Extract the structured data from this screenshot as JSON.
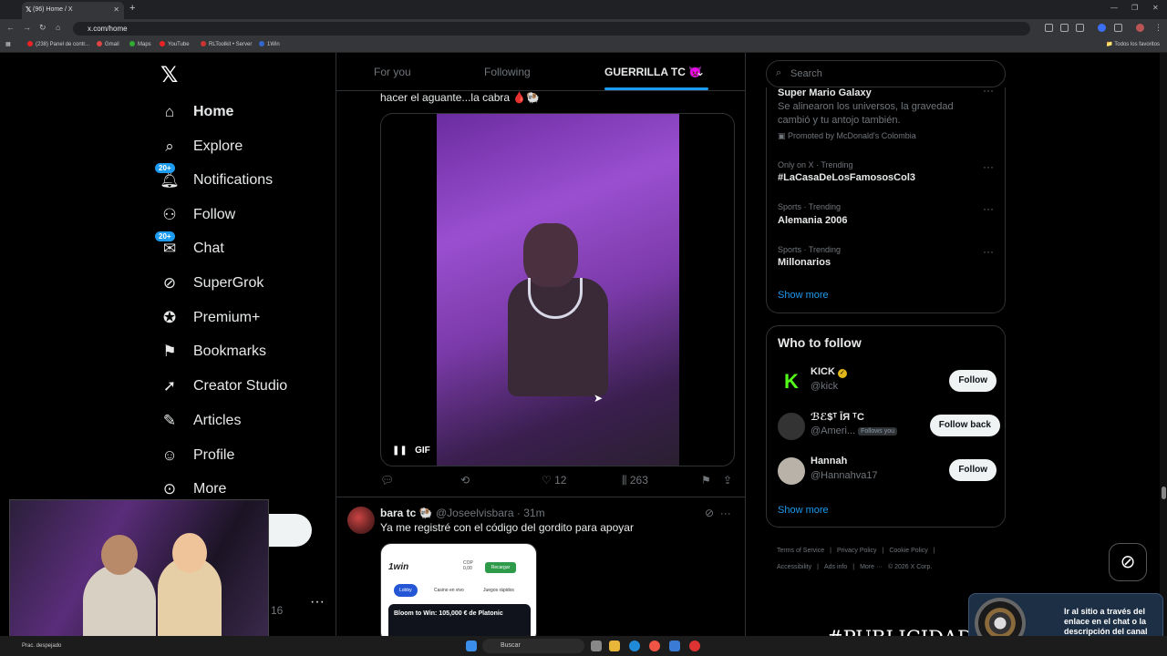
{
  "browser": {
    "tab_title": "(96) Home / X",
    "url": "x.com/home",
    "bookmarks": [
      "(238) Panel de contr...",
      "Gmail",
      "Maps",
      "YouTube",
      "RLToolkit • Server",
      "1Win"
    ],
    "all_bookmarks": "Todos los favoritos"
  },
  "nav": {
    "items": [
      {
        "label": "Home",
        "icon": "home-icon",
        "active": true
      },
      {
        "label": "Explore",
        "icon": "search-icon"
      },
      {
        "label": "Notifications",
        "icon": "bell-icon",
        "badge": "20+"
      },
      {
        "label": "Follow",
        "icon": "person-add-icon"
      },
      {
        "label": "Chat",
        "icon": "chat-icon",
        "badge": "20+"
      },
      {
        "label": "SuperGrok",
        "icon": "grok-icon"
      },
      {
        "label": "Premium+",
        "icon": "verified-icon"
      },
      {
        "label": "Bookmarks",
        "icon": "bookmark-icon"
      },
      {
        "label": "Creator Studio",
        "icon": "rocket-icon"
      },
      {
        "label": "Articles",
        "icon": "article-icon"
      },
      {
        "label": "Profile",
        "icon": "person-icon"
      },
      {
        "label": "More",
        "icon": "more-circle-icon"
      }
    ],
    "account_suffix": "16"
  },
  "timeline": {
    "tabs": [
      "For you",
      "Following",
      "GUERRILLA TC 👿"
    ],
    "tweet1": {
      "text": "hacer el aguante...la cabra 🩸🐏",
      "gif_label": "GIF",
      "likes": "12",
      "views": "263"
    },
    "tweet2": {
      "name": "bara tc 🐏",
      "handle": "@Joseelvisbara",
      "time": "· 31m",
      "text": "Ya me registré con el código del gordito para apoyar",
      "img": {
        "logo": "1win",
        "currency": "COP",
        "balance": "0,00",
        "recharge": "Recargar",
        "tabs": [
          "Lobby",
          "Casino en vivo",
          "Juegos rápidos"
        ],
        "banner": "Bloom to Win: 105,000 € de Platonic"
      }
    }
  },
  "sidebar": {
    "search_placeholder": "Search",
    "promoted": {
      "title": "Super Mario Galaxy",
      "desc": "Se alinearon los universos, la gravedad cambió y tu antojo también.",
      "by": "Promoted by McDonald's Colombia"
    },
    "trends": [
      {
        "meta": "Only on X · Trending",
        "title": "#LaCasaDeLosFamososCol3"
      },
      {
        "meta": "Sports · Trending",
        "title": "Alemania 2006"
      },
      {
        "meta": "Sports · Trending",
        "title": "Millonarios"
      }
    ],
    "show_more": "Show more",
    "who_to_follow": {
      "title": "Who to follow",
      "users": [
        {
          "name": "KICK",
          "handle": "@kick",
          "button": "Follow"
        },
        {
          "name": "ℬℰ$ᵀ ĪЯ ᵀC",
          "handle": "@Ameri...",
          "follows_you": "Follows you",
          "button": "Follow back"
        },
        {
          "name": "Hannah",
          "handle": "@Hannahva17",
          "button": "Follow"
        }
      ],
      "show_more": "Show more"
    },
    "footer": [
      "Terms of Service",
      "|",
      "Privacy Policy",
      "|",
      "Cookie Policy",
      "|",
      "Accessibility",
      "|",
      "Ads info",
      "|",
      "More ···",
      "© 2026 X Corp."
    ]
  },
  "overlays": {
    "publicidad": "#PUBLICIDAD",
    "promo_text": "Ir al sitio a través del enlace en el chat o la descripción del canal"
  },
  "taskbar": {
    "weather": "Prac. despejado",
    "search": "Buscar"
  }
}
